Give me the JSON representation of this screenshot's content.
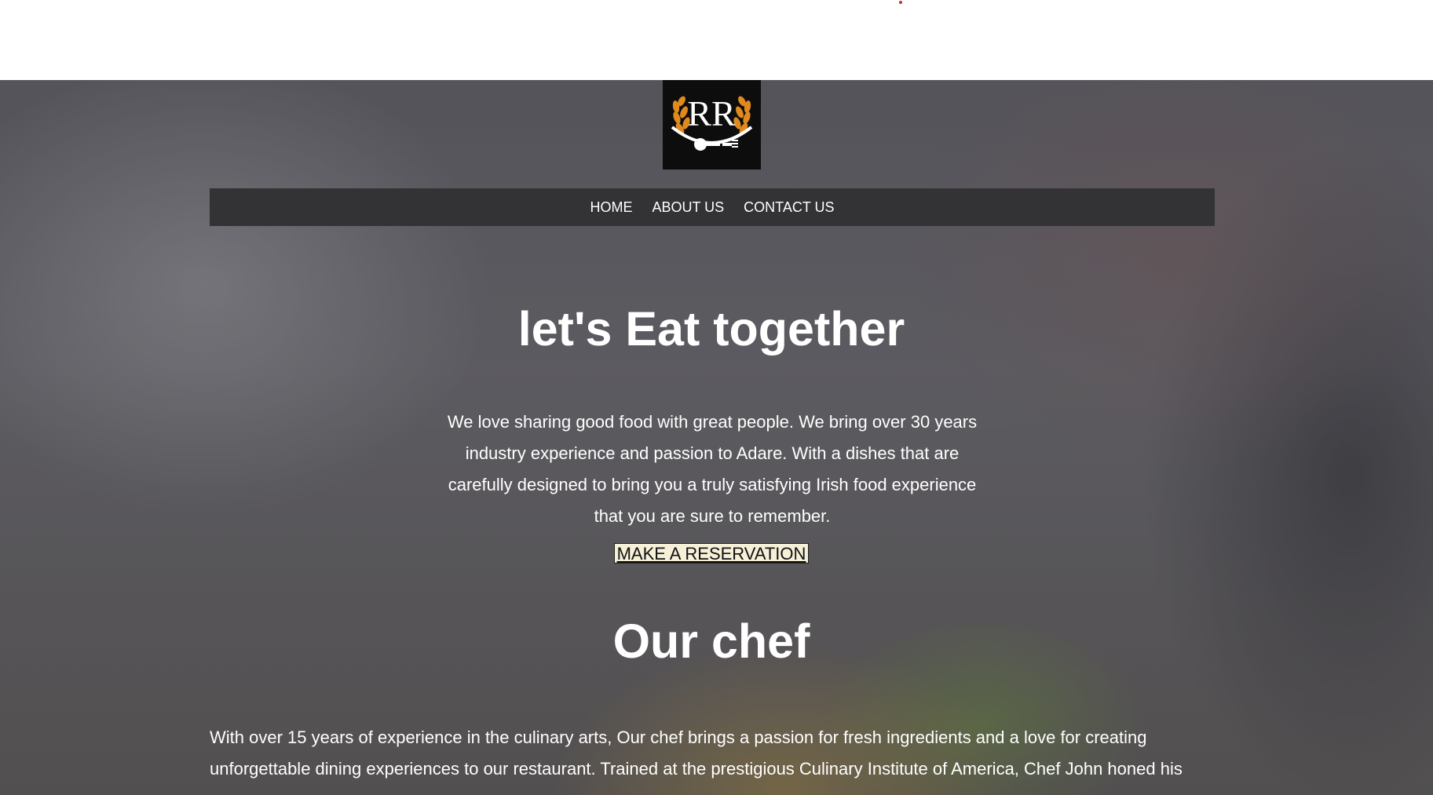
{
  "nav": {
    "items": [
      {
        "label": "HOME"
      },
      {
        "label": "ABOUT US"
      },
      {
        "label": "CONTACT US"
      }
    ]
  },
  "logo": {
    "text": "RR",
    "icon": "restaurant-logo-icon"
  },
  "hero": {
    "headline": "let's Eat together",
    "intro": "We love sharing good food with great people. We bring over 30 years industry experience and passion to Adare. With a dishes that are carefully designed to bring you a truly satisfying Irish food experience that you are sure to remember.",
    "cta_label": "MAKE A RESERVATION"
  },
  "chef": {
    "title": "Our chef",
    "text": "With over 15 years of experience in the culinary arts, Our chef brings a passion for fresh ingredients and a love for creating unforgettable dining experiences to our restaurant. Trained at the prestigious Culinary Institute of America, Chef John honed his"
  },
  "colors": {
    "nav_bg": "#333335",
    "cta_bg": "#f6f0d8",
    "logo_bg": "#0d0d0d",
    "logo_accent": "#e08a1e"
  }
}
